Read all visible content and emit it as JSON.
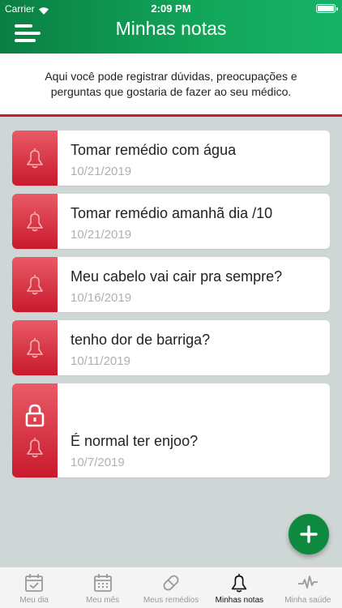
{
  "status_bar": {
    "carrier": "Carrier",
    "time": "2:09 PM"
  },
  "header": {
    "title": "Minhas notas",
    "menu_icon": "hamburger-menu-icon"
  },
  "intro": {
    "text": "Aqui você pode registrar dúvidas, preocupações e perguntas que gostaria de fazer ao seu médico."
  },
  "notes": [
    {
      "text": "Tomar remédio com água",
      "date": "10/21/2019"
    },
    {
      "text": "Tomar remédio amanhã dia /10",
      "date": "10/21/2019"
    },
    {
      "text": "Meu cabelo vai cair pra sempre?",
      "date": "10/16/2019"
    },
    {
      "text": "tenho dor de barriga?",
      "date": "10/11/2019"
    },
    {
      "text": "É normal ter enjoo?",
      "date": "10/7/2019",
      "locked": true
    }
  ],
  "fab": {
    "icon": "plus-icon"
  },
  "tabs": [
    {
      "label": "Meu dia",
      "icon": "calendar-check-icon"
    },
    {
      "label": "Meu mês",
      "icon": "calendar-grid-icon"
    },
    {
      "label": "Meus remédios",
      "icon": "pill-icon"
    },
    {
      "label": "Minhas notas",
      "icon": "bell-icon",
      "active": true
    },
    {
      "label": "Minha saúde",
      "icon": "heartbeat-icon"
    }
  ],
  "colors": {
    "header_green": "#12a65a",
    "note_red": "#c81a2c",
    "fab_green": "#0d8a3f",
    "background": "#cfd6d6"
  }
}
